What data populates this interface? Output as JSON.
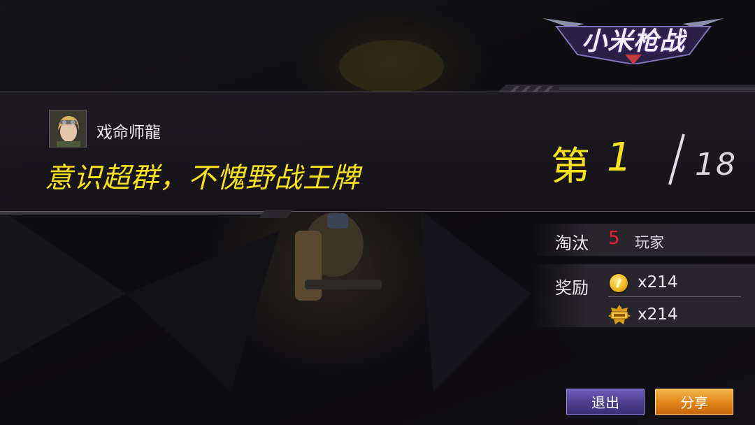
{
  "game": {
    "logo_text": "小米枪战"
  },
  "result": {
    "player_name": "戏命师龍",
    "slogan": "意识超群，不愧野战王牌",
    "rank_prefix": "第",
    "rank": "1",
    "total_players": "18"
  },
  "stats": {
    "elim_label": "淘汰",
    "elim_count": "5",
    "elim_unit": "玩家",
    "reward_label": "奖励",
    "rewards": [
      {
        "icon": "gold-coin-icon",
        "amount": "x214"
      },
      {
        "icon": "experience-badge-icon",
        "amount": "x214"
      }
    ]
  },
  "buttons": {
    "exit": "退出",
    "share": "分享"
  },
  "colors": {
    "highlight_yellow": "#f7e01c",
    "elim_red": "#e8202a",
    "exit_purple": "#4c3d8e",
    "share_orange": "#e08418"
  }
}
